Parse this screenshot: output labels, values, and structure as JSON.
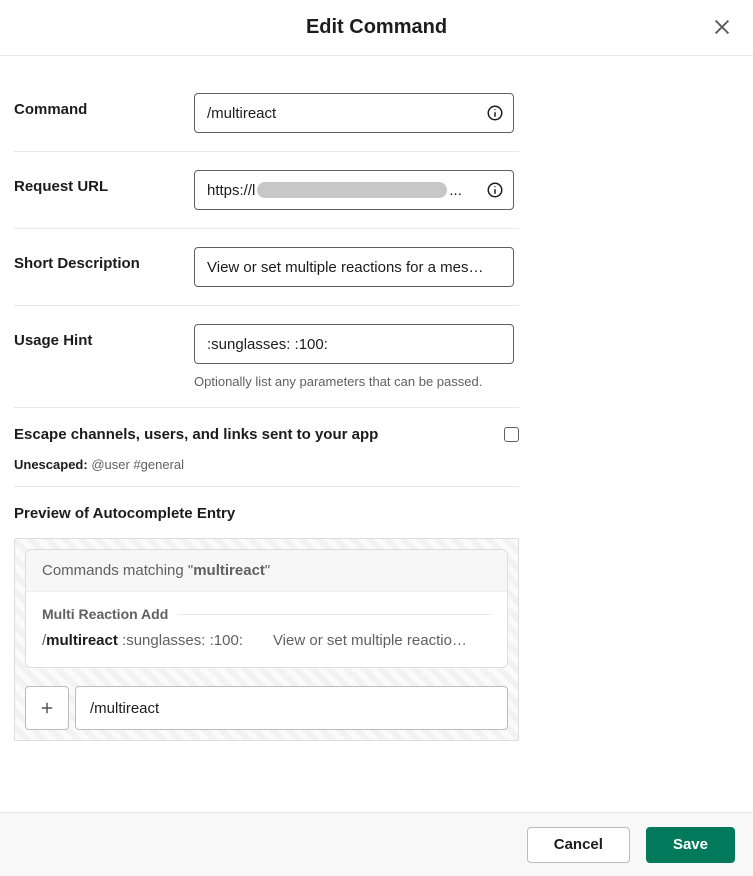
{
  "header": {
    "title": "Edit Command"
  },
  "fields": {
    "command": {
      "label": "Command",
      "value": "/multireact"
    },
    "request_url": {
      "label": "Request URL",
      "value_prefix": "https://",
      "value_suffix": "..."
    },
    "short_description": {
      "label": "Short Description",
      "value": "View or set multiple reactions for a mes…"
    },
    "usage_hint": {
      "label": "Usage Hint",
      "value": ":sunglasses: :100:",
      "hint": "Optionally list any parameters that can be passed."
    }
  },
  "escape": {
    "label": "Escape channels, users, and links sent to your app",
    "checked": false,
    "hint_prefix": "Unescaped:",
    "hint_value": "@user #general"
  },
  "preview": {
    "title": "Preview of Autocomplete Entry",
    "matching_prefix": "Commands matching \"",
    "matching_term": "multireact",
    "matching_suffix": "\"",
    "app_name": "Multi Reaction Add",
    "command_slash": "/",
    "command_bold": "multireact",
    "command_hint": " :sunglasses: :100:",
    "command_desc": "View or set multiple reactio…",
    "compose_value": "/multireact"
  },
  "footer": {
    "cancel": "Cancel",
    "save": "Save"
  }
}
